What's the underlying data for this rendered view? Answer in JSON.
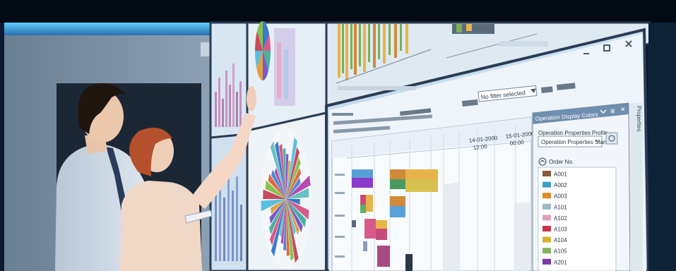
{
  "screen": {
    "filter": {
      "value": "No filter selected"
    },
    "panel": {
      "title": "Operation Display Colors",
      "profile_label": "Operation Properties Profile",
      "profile_value": "Operation Properties Stan",
      "order_header": "Order No.",
      "side_tab": "Properties",
      "orders": [
        {
          "code": "A001",
          "color": "#8a5a3a"
        },
        {
          "code": "A002",
          "color": "#3aa0c8"
        },
        {
          "code": "A003",
          "color": "#e08a2a"
        },
        {
          "code": "A101",
          "color": "#9ab8c8"
        },
        {
          "code": "A102",
          "color": "#e2a0b8"
        },
        {
          "code": "A103",
          "color": "#c8324a"
        },
        {
          "code": "A104",
          "color": "#d8b030"
        },
        {
          "code": "A105",
          "color": "#8ab060"
        },
        {
          "code": "A201",
          "color": "#7a3aa8"
        }
      ]
    },
    "gantt": {
      "dates": [
        {
          "date": "14-01-2000",
          "time": "12:00"
        },
        {
          "date": "15-01-2000",
          "time": "00:00"
        }
      ]
    }
  },
  "colors": {
    "frame": "#0b1a2e",
    "screen_bg": "#e9f1f8",
    "panel_header": "#6f8fb0",
    "room_wall": "#5e7389"
  }
}
